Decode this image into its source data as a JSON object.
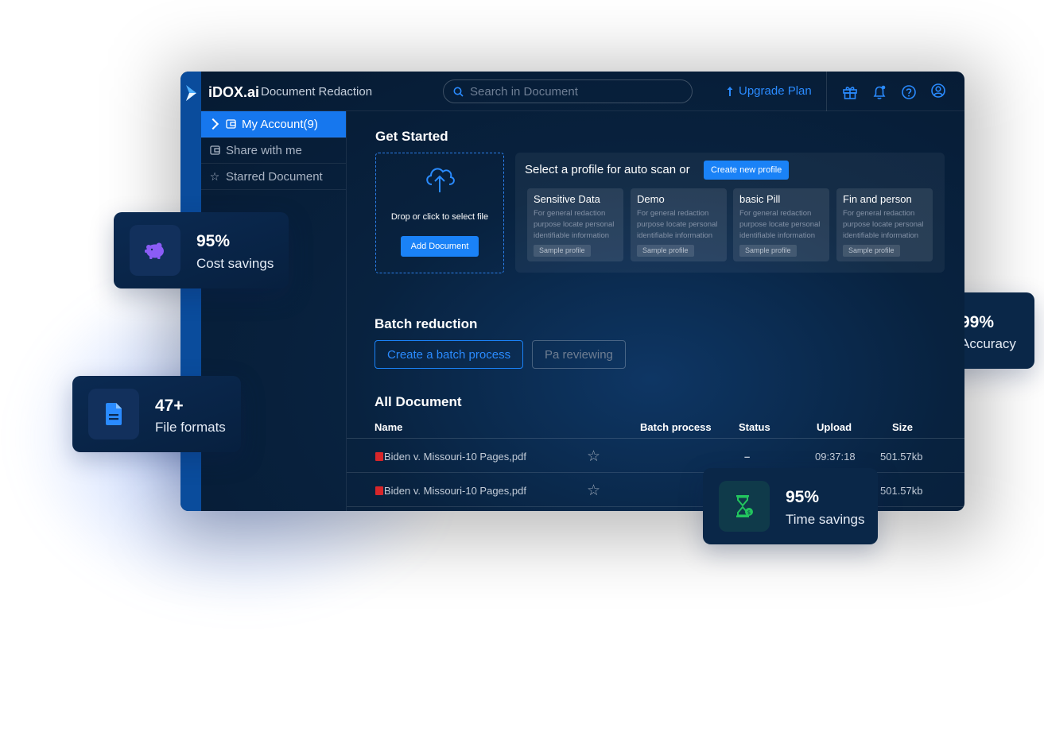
{
  "app": {
    "brand": "iDOX.ai",
    "subtitle": "Document Redaction",
    "search_placeholder": "Search in Document",
    "upgrade_label": "Upgrade Plan",
    "accent_color": "#1a82f7"
  },
  "sidebar": {
    "items": [
      {
        "label": "My Account(9)",
        "icon": "wallet-icon",
        "active": true
      },
      {
        "label": "Share with me",
        "icon": "wallet-icon",
        "active": false
      },
      {
        "label": "Starred Document",
        "icon": "star-icon",
        "active": false
      }
    ]
  },
  "get_started": {
    "title": "Get Started",
    "drop_text": "Drop or click to select file",
    "add_button": "Add Document",
    "profile_prompt": "Select a profile for auto scan or",
    "create_profile_button": "Create new profile",
    "profiles": [
      {
        "name": "Sensitive Data",
        "description": "For general redaction purpose locate personal identifiable information",
        "tag": "Sample profile"
      },
      {
        "name": "Demo",
        "description": "For general redaction purpose locate personal identifiable information",
        "tag": "Sample profile"
      },
      {
        "name": "basic Pill",
        "description": "For general redaction purpose locate personal identifiable information",
        "tag": "Sample profile"
      },
      {
        "name": "Fin and person",
        "description": "For general redaction purpose locate personal identifiable information",
        "tag": "Sample profile"
      }
    ]
  },
  "batch": {
    "title": "Batch reduction",
    "create_button": "Create a batch process",
    "reviewing_button": "Pa reviewing"
  },
  "documents": {
    "title": "All Document",
    "columns": [
      "Name",
      "Batch process",
      "Status",
      "Upload",
      "Size"
    ],
    "rows": [
      {
        "name": "Biden v. Missouri-10 Pages,pdf",
        "batch": "",
        "status": "–",
        "upload": "09:37:18",
        "size": "501.57kb"
      },
      {
        "name": "Biden v. Missouri-10 Pages,pdf",
        "batch": "",
        "status": "",
        "upload": "",
        "size": "501.57kb"
      }
    ]
  },
  "badges": {
    "cost": {
      "value": "95%",
      "label": "Cost savings",
      "icon": "piggy-bank-icon",
      "color": "#8b5cf6"
    },
    "formats": {
      "value": "47+",
      "label": "File formats",
      "icon": "document-icon",
      "color": "#2a8bff"
    },
    "accuracy": {
      "value": "99%",
      "label": "Accuracy"
    },
    "time": {
      "value": "95%",
      "label": "Time savings",
      "icon": "hourglass-icon",
      "color": "#22c55e"
    }
  }
}
